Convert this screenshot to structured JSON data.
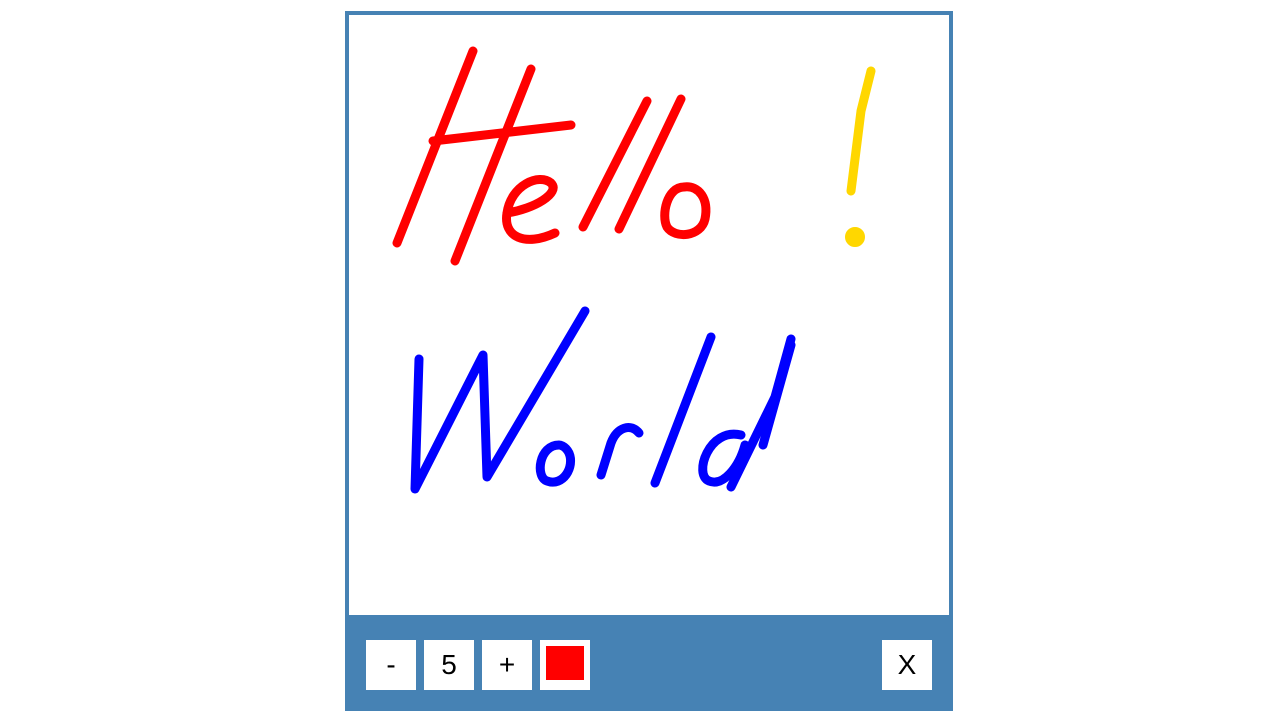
{
  "toolbar": {
    "decrease_label": "-",
    "brush_size": "5",
    "increase_label": "+",
    "current_color": "#ff0000",
    "close_label": "X"
  },
  "drawing": {
    "strokes": [
      {
        "text": "Hello",
        "color": "#ff0000"
      },
      {
        "text": "!",
        "color": "#ffd700"
      },
      {
        "text": "World",
        "color": "#0000ff"
      }
    ]
  },
  "colors": {
    "frame": "#4682b4",
    "canvas": "#ffffff"
  }
}
